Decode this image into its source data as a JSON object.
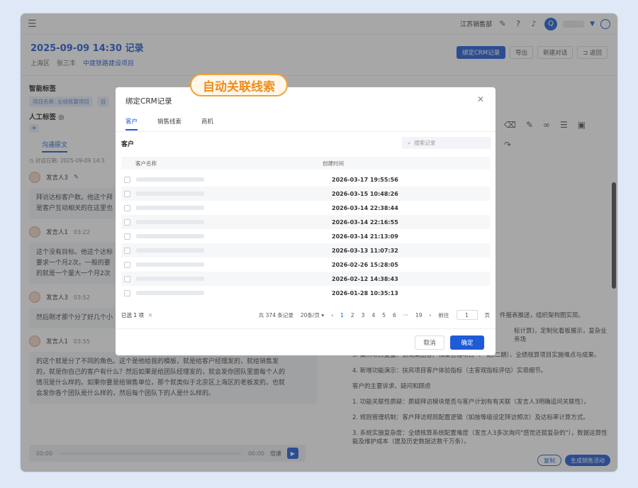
{
  "topbar": {
    "org": "江苏销售部",
    "avatar_letter": "Q"
  },
  "header": {
    "title": "2025-09-09 14:30 记录",
    "meta": [
      "上海区",
      "张三丰",
      "中建铁路建设项目"
    ],
    "buttons": [
      "绑定CRM记录",
      "导出",
      "新建对话",
      "⊐ 返回"
    ]
  },
  "left": {
    "smart_tags_title": "智能标签",
    "smart_tags": [
      "项目名称: 业绩核算项目",
      "目"
    ],
    "manual_tags_title": "人工标签 ◎",
    "tab": "沟通原文",
    "dialog_time": "◷ 对话日期: 2025-09-09 14:3",
    "speakers": [
      {
        "name": "发言人3",
        "time": "",
        "text": [
          "拜访达标客户数。他这个拜",
          "是客户互动相关的在这里也"
        ]
      },
      {
        "name": "发言人1",
        "time": "03:22",
        "text": [
          "这个没有目标。他这个达标",
          "要求一个月2次。一般的要",
          "的就是一个量大一个月2次"
        ]
      },
      {
        "name": "发言人3",
        "time": "03:52",
        "text": [
          "然后刚才那个分了好几个小"
        ]
      },
      {
        "name": "发言人1",
        "time": "03:55",
        "text": [
          "的这个就是分了不同的角色。这个是他给我的模板，就是给客户经理发的，就给销售发",
          "的，就是你自己的客户有什么？然后如果是给团队经理发的，就会发你团队里面每个人的",
          "情况是什么样的。如果你要是给销售单位，那个就类似于北京区上海区的老板发的，也就",
          "会发你各个团队是什么样的，然后每个团队下的人是什么样的。"
        ]
      }
    ],
    "player": {
      "start": "00:00",
      "end": "00:00",
      "speed": "倍速"
    }
  },
  "right": {
    "lines": [
      "件报表推送，组织架构图实现。",
      "标计算)，定制化看板展示，复杂业务场",
      "3. 案例项目复盘：浪潮集团客户档案管理项目（一期/二期）、全绩核算项目实施难点与成果。",
      "4. 新增功能演示：扶风项目客户体验指标（主客观指标评估）实现细节。",
      "客户的主要诉求、疑问和顾虑",
      "1. 功能关联性质疑：质疑拜访模块是否与客户计划有有关联（发言人3明确追问关联性）。",
      "2. 规则管理机制：客户拜访规则配置逻辑（如按等级设定拜访频次）及达标率计算方式。",
      "3. 系统实施复杂度：全绩核算系统配置难度（发言人3多次询问\"感觉还挺复杂的\"），数据运算性能及维护成本（提及历史数据达数千万条）。"
    ],
    "copy": "复制",
    "generate": "生成销售活动"
  },
  "modal": {
    "title": "绑定CRM记录",
    "tabs": [
      "客户",
      "销售线索",
      "商机"
    ],
    "section": "客户",
    "search_placeholder": "搜索记录",
    "columns": [
      "客户名称",
      "创建时间"
    ],
    "rows": [
      "2026-03-17 19:55:56",
      "2026-03-15 10:48:26",
      "2026-03-14 22:38:44",
      "2026-03-14 22:16:55",
      "2026-03-14 21:13:09",
      "2026-03-13 11:07:32",
      "2026-02-26 15:28:05",
      "2026-02-12 14:38:43",
      "2026-01-28 10:35:13"
    ],
    "selected": "已选 1 项",
    "total": "共 374 条记录",
    "page_size": "20条/页",
    "pages": [
      "1",
      "2",
      "3",
      "4",
      "5",
      "6",
      "···",
      "19"
    ],
    "goto": "前往",
    "goto_value": "1",
    "page_unit": "页",
    "cancel": "取消",
    "confirm": "确定"
  },
  "callout": "自动关联线索"
}
